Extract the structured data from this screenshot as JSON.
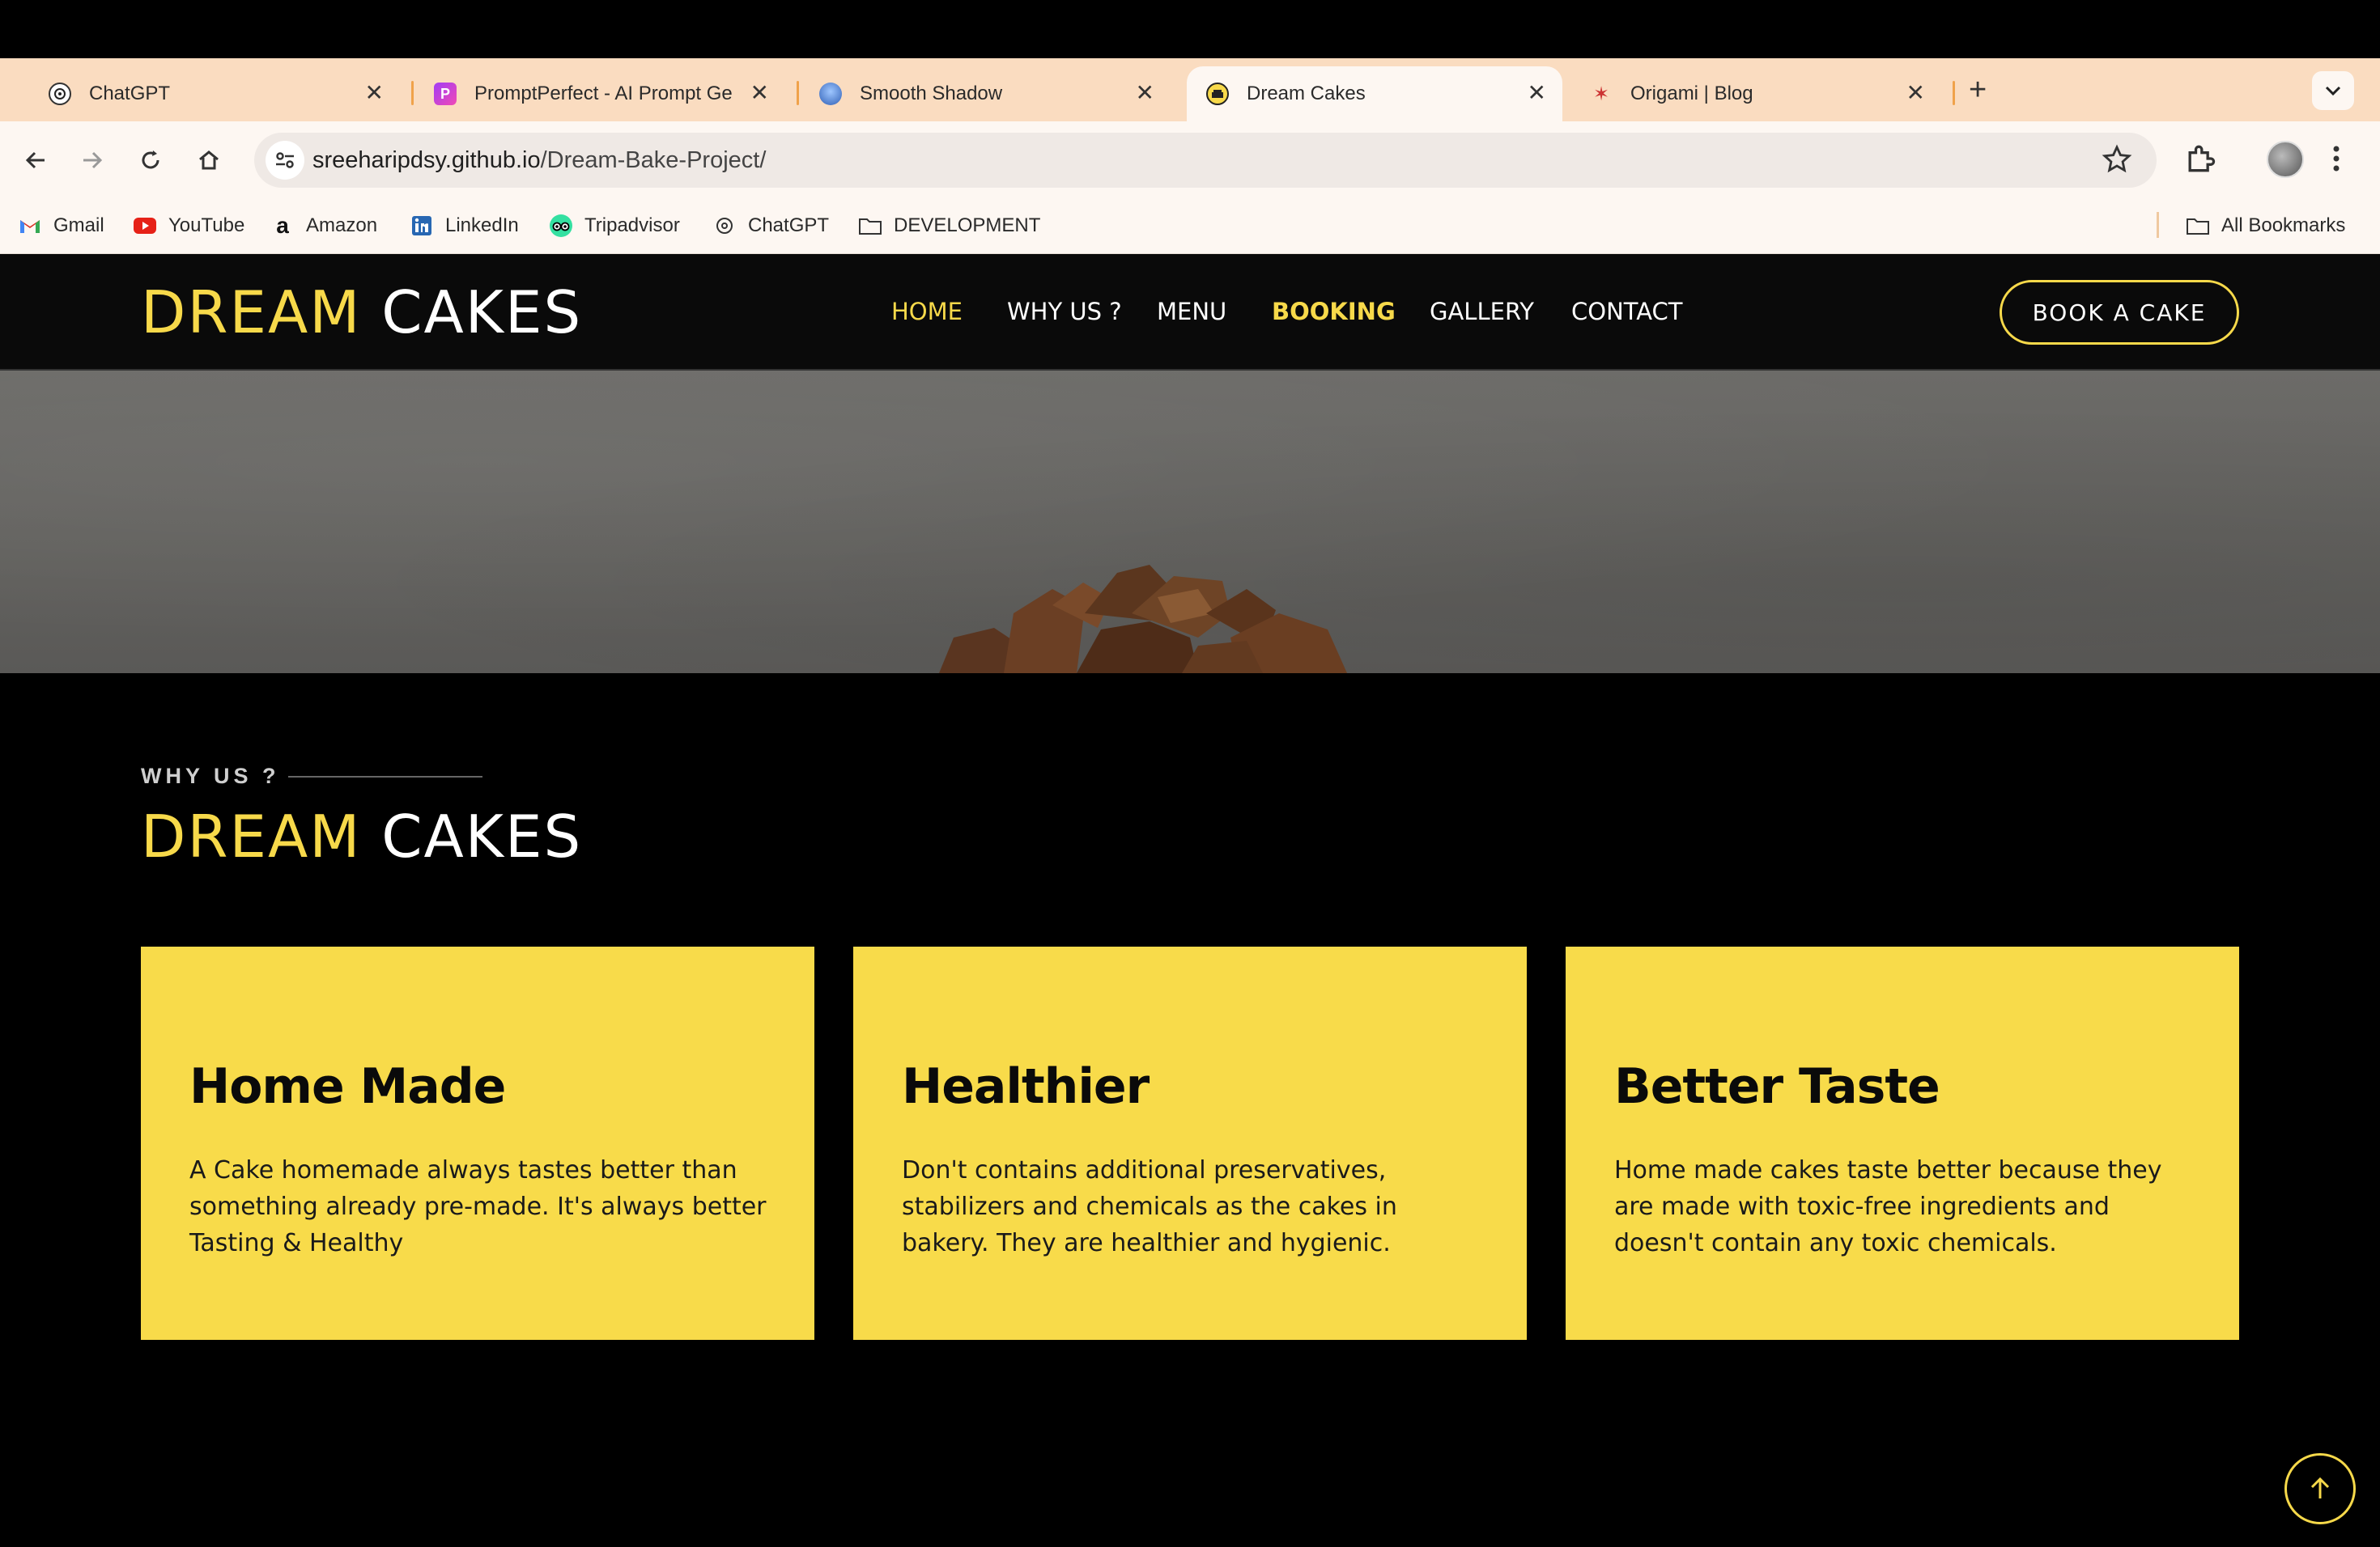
{
  "browser": {
    "tabs": [
      {
        "title": "ChatGPT",
        "icon": "chatgpt-icon"
      },
      {
        "title": "PromptPerfect - AI Prompt Ge",
        "icon": "promptperfect-icon"
      },
      {
        "title": "Smooth Shadow",
        "icon": "smooth-shadow-icon"
      },
      {
        "title": "Dream Cakes",
        "icon": "dream-cakes-icon",
        "active": true
      },
      {
        "title": "Origami | Blog",
        "icon": "origami-icon"
      }
    ],
    "url_host": "sreeharipdsy.github.io",
    "url_path": "/Dream-Bake-Project/",
    "bookmarks": [
      {
        "label": "Gmail",
        "icon": "gmail-icon"
      },
      {
        "label": "YouTube",
        "icon": "youtube-icon"
      },
      {
        "label": "Amazon",
        "icon": "amazon-icon"
      },
      {
        "label": "LinkedIn",
        "icon": "linkedin-icon"
      },
      {
        "label": "Tripadvisor",
        "icon": "tripadvisor-icon"
      },
      {
        "label": "ChatGPT",
        "icon": "chatgpt-icon"
      },
      {
        "label": "DEVELOPMENT",
        "icon": "folder-icon"
      }
    ],
    "all_bookmarks": "All Bookmarks"
  },
  "site": {
    "logo_accent": "DREAM",
    "logo_rest": "CAKES",
    "nav": [
      "HOME",
      "WHY US ?",
      "MENU",
      "BOOKING",
      "GALLERY",
      "CONTACT"
    ],
    "cta": "BOOK A CAKE",
    "accent_color": "#f7d94a"
  },
  "why_us": {
    "eyebrow": "WHY US ?",
    "title_accent": "DREAM",
    "title_rest": "CAKES",
    "cards": [
      {
        "title": "Home Made",
        "text": "A Cake homemade always tastes better than something already pre-made. It's always better Tasting & Healthy"
      },
      {
        "title": "Healthier",
        "text": "Don't contains additional preservatives, stabilizers and chemicals as the cakes in bakery. They are healthier and hygienic."
      },
      {
        "title": "Better Taste",
        "text": "Home made cakes taste better because they are made with toxic-free ingredients and doesn't contain any toxic chemicals."
      }
    ]
  }
}
